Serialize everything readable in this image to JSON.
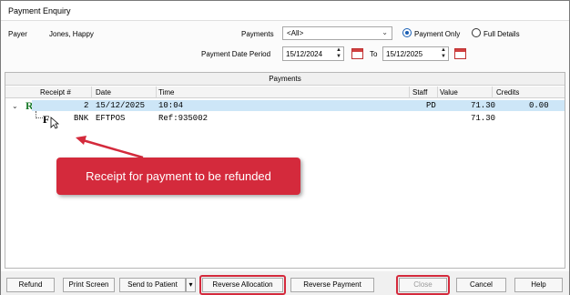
{
  "window": {
    "title": "Payment Enquiry"
  },
  "payer": {
    "label": "Payer",
    "name": "Jones, Happy"
  },
  "filters": {
    "payments_label": "Payments",
    "payments_value": "<All>",
    "payment_only_label": "Payment Only",
    "full_details_label": "Full Details",
    "date_period_label": "Payment Date Period",
    "from_date": "15/12/2024",
    "to_label": "To",
    "to_date": "15/12/2025"
  },
  "grid": {
    "caption": "Payments",
    "columns": [
      "Receipt #",
      "Date",
      "Time",
      "Staff",
      "Value",
      "Credits"
    ],
    "row1": {
      "receipt": "2",
      "date": "15/12/2025",
      "time": "10:04",
      "staff": "PD",
      "value": "71.30",
      "credits": "0.00"
    },
    "row2": {
      "type": "BNK",
      "method": "EFTPOS",
      "ref": "Ref:935002",
      "value": "71.30"
    }
  },
  "annotation": {
    "text": "Receipt for payment to be refunded",
    "color": "#d42a3c"
  },
  "buttons": {
    "refund": "Refund",
    "print_screen": "Print Screen",
    "send_to_patient": "Send to Patient",
    "reverse_allocation": "Reverse Allocation",
    "reverse_payment": "Reverse Payment",
    "close": "Close",
    "cancel": "Cancel",
    "help": "Help"
  }
}
